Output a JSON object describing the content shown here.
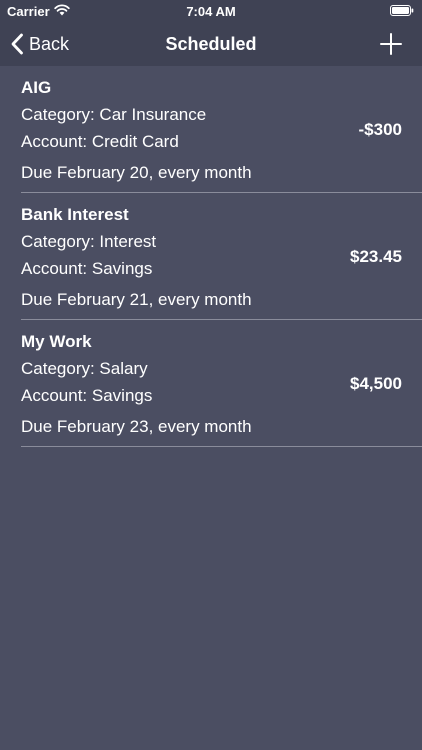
{
  "status": {
    "carrier": "Carrier",
    "time": "7:04 AM"
  },
  "nav": {
    "back_label": "Back",
    "title": "Scheduled"
  },
  "items": [
    {
      "name": "AIG",
      "category": "Category: Car Insurance",
      "account": "Account: Credit Card",
      "due": "Due February 20, every month",
      "amount": "-$300"
    },
    {
      "name": "Bank Interest",
      "category": "Category: Interest",
      "account": "Account: Savings",
      "due": "Due February 21, every month",
      "amount": "$23.45"
    },
    {
      "name": "My Work",
      "category": "Category: Salary",
      "account": "Account: Savings",
      "due": "Due February 23, every month",
      "amount": "$4,500"
    }
  ],
  "colors": {
    "background": "#4b4e62",
    "bar": "#3f4254",
    "separator": "#8a8c9b",
    "text": "#ffffff"
  }
}
